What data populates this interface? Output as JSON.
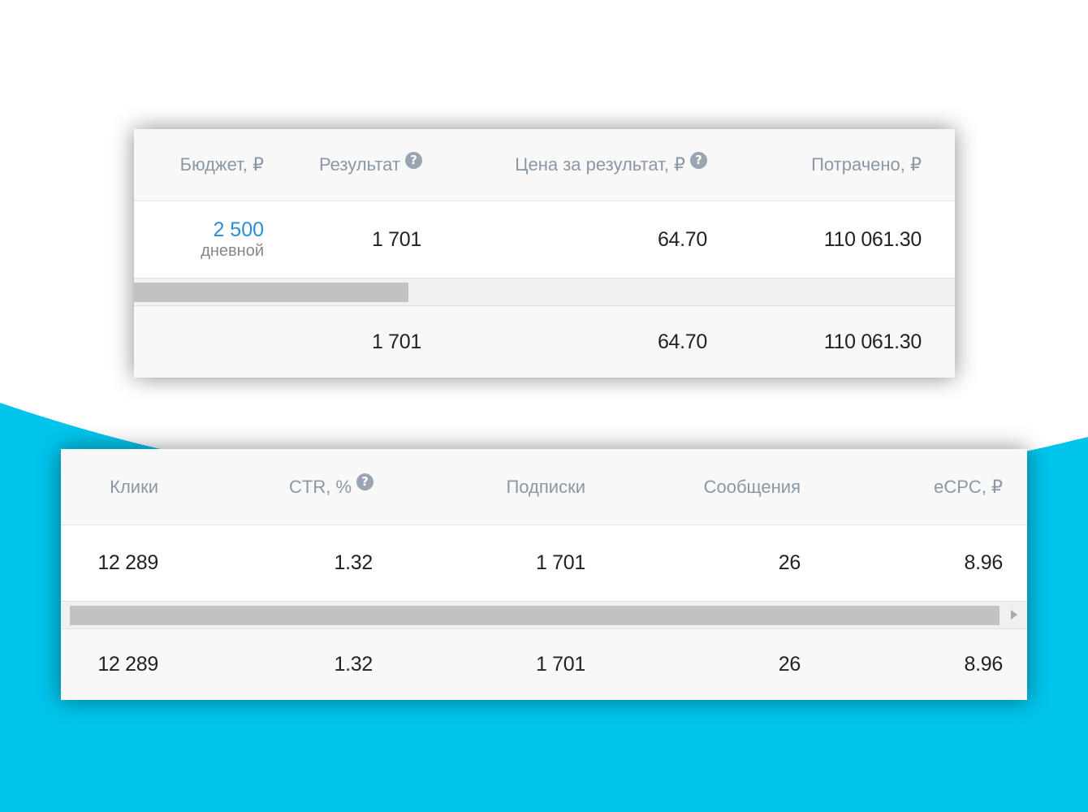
{
  "colors": {
    "accent": "#00c4ec",
    "link_blue": "#2a8fd4",
    "header_text": "#8a97a6",
    "value_text": "#222222"
  },
  "top_table": {
    "headers": {
      "budget": "Бюджет, ₽",
      "result": "Результат",
      "cost_per_result": "Цена за результат, ₽",
      "spent": "Потрачено, ₽"
    },
    "help_icon": "?",
    "row": {
      "budget_value": "2 500",
      "budget_period": "дневной",
      "result": "1 701",
      "cost_per_result": "64.70",
      "spent": "110 061.30"
    },
    "totals": {
      "result": "1 701",
      "cost_per_result": "64.70",
      "spent": "110 061.30"
    }
  },
  "bottom_table": {
    "headers": {
      "clicks": "Клики",
      "ctr": "CTR, %",
      "subscriptions": "Подписки",
      "messages": "Сообщения",
      "ecpc": "eCPC, ₽"
    },
    "help_icon": "?",
    "row": {
      "clicks": "12 289",
      "ctr": "1.32",
      "subscriptions": "1 701",
      "messages": "26",
      "ecpc": "8.96"
    },
    "totals": {
      "clicks": "12 289",
      "ctr": "1.32",
      "subscriptions": "1 701",
      "messages": "26",
      "ecpc": "8.96"
    }
  },
  "icons": {
    "help": "help-icon",
    "scroll_right": "arrow-right-icon"
  }
}
